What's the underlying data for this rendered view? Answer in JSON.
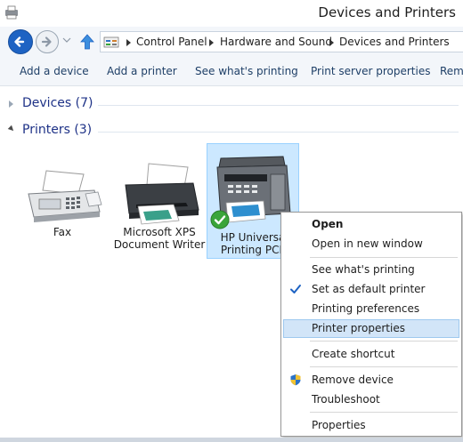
{
  "window": {
    "title": "Devices and Printers",
    "icon": "devices-printers-icon"
  },
  "nav": {
    "back_icon": "back-arrow-icon",
    "forward_icon": "forward-arrow-icon",
    "recent_icon": "chevron-down-icon",
    "up_icon": "up-arrow-icon"
  },
  "address": {
    "icon": "control-panel-icon",
    "crumbs": [
      "Control Panel",
      "Hardware and Sound",
      "Devices and Printers"
    ]
  },
  "toolbar": {
    "buttons": [
      "Add a device",
      "Add a printer",
      "See what's printing",
      "Print server properties",
      "Remo"
    ]
  },
  "groups": {
    "devices": {
      "label": "Devices (7)",
      "expanded": false
    },
    "printers": {
      "label": "Printers (3)",
      "expanded": true
    }
  },
  "printers": [
    {
      "line1": "Fax",
      "line2": "",
      "icon": "fax-machine-icon"
    },
    {
      "line1": "Microsoft XPS",
      "line2": "Document Writer",
      "icon": "printer-icon"
    },
    {
      "line1": "HP Universa",
      "line2": "Printing PCL",
      "icon": "multifunction-printer-icon",
      "default": true,
      "selected": true
    }
  ],
  "context_menu": {
    "items": [
      "Open",
      "Open in new window",
      "See what's printing",
      "Set as default printer",
      "Printing preferences",
      "Printer properties",
      "Create shortcut",
      "Remove device",
      "Troubleshoot",
      "Properties"
    ],
    "bold_item": "Open",
    "highlighted_item": "Printer properties",
    "checked_item": "Set as default printer",
    "shield_item": "Remove device"
  },
  "colors": {
    "accent": "#1e63c3",
    "selection": "#cce8ff",
    "menu_highlight": "#d2e5f8",
    "group_header": "#1e3287",
    "default_check": "#3aa53a"
  }
}
